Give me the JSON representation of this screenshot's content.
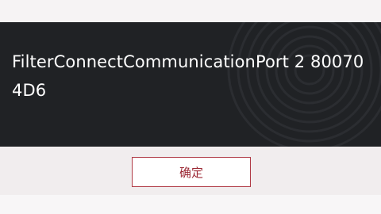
{
  "dialog": {
    "message": "FilterConnectCommunicationPort 2 800704D6",
    "ok_label": "确定"
  },
  "colors": {
    "dialog_background": "#202225",
    "message_text": "#ffffff",
    "button_border": "#b03a45",
    "button_text": "#9c2935",
    "footer_background": "#f1edee"
  }
}
